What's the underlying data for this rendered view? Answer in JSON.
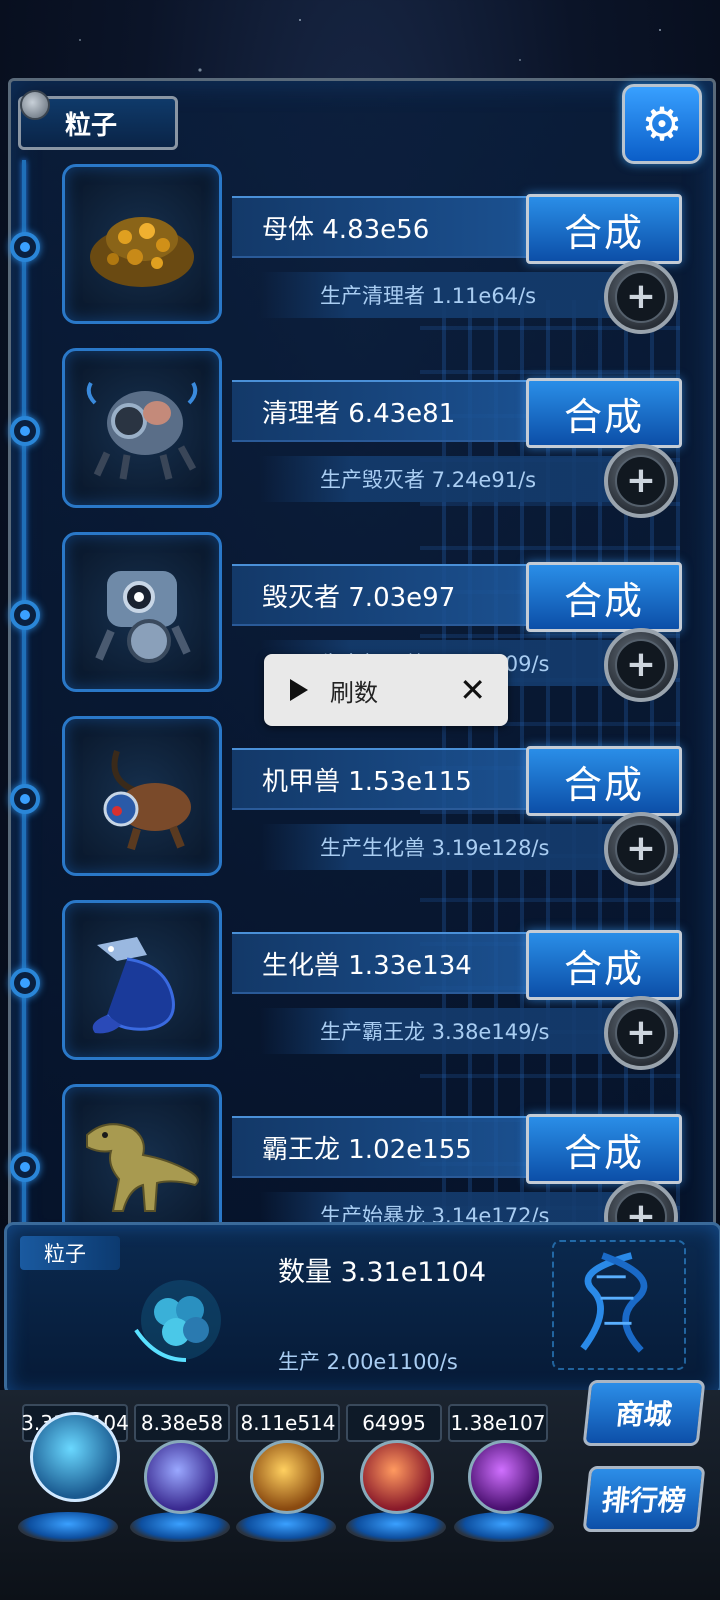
{
  "header": {
    "label": "粒子"
  },
  "units": [
    {
      "name": "母体 4.83e56",
      "produce": "生产清理者 1.11e64/s",
      "button": "合成"
    },
    {
      "name": "清理者 6.43e81",
      "produce": "生产毁灭者 7.24e91/s",
      "button": "合成"
    },
    {
      "name": "毁灭者 7.03e97",
      "produce": "生产机甲兽 2.41e109/s",
      "button": "合成"
    },
    {
      "name": "机甲兽 1.53e115",
      "produce": "生产生化兽 3.19e128/s",
      "button": "合成"
    },
    {
      "name": "生化兽 1.33e134",
      "produce": "生产霸王龙 3.38e149/s",
      "button": "合成"
    },
    {
      "name": "霸王龙 1.02e155",
      "produce": "生产始暴龙 3.14e172/s",
      "button": "合成"
    }
  ],
  "toast": {
    "label": "刷数"
  },
  "particle_panel": {
    "label": "粒子",
    "count": "数量 3.31e1104",
    "rate": "生产 2.00e1100/s"
  },
  "resources": [
    "3.31e1104",
    "8.38e58",
    "8.11e514",
    "64995",
    "1.38e107"
  ],
  "side_buttons": {
    "shop": "商城",
    "ranking": "排行榜"
  },
  "colors": {
    "accent": "#1f6fb8",
    "button": "#2a8ee8",
    "panel": "#0b2a50"
  }
}
